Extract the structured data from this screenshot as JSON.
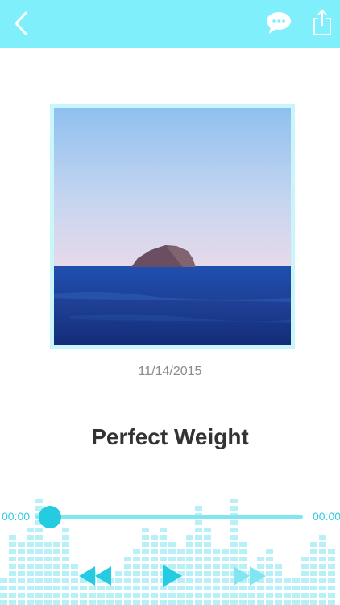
{
  "colors": {
    "accent": "#25cbe0",
    "header": "#7ff0fb",
    "frame": "#c9f6fb"
  },
  "header": {
    "back_icon": "chevron-left-icon",
    "comment_icon": "speech-bubble-icon",
    "share_icon": "share-icon"
  },
  "track": {
    "date": "11/14/2015",
    "title": "Perfect Weight"
  },
  "player": {
    "elapsed": "00:00",
    "duration": "00:00",
    "progress": 0.02,
    "controls": [
      "rewind-icon",
      "play-icon",
      "fast-forward-icon"
    ]
  }
}
